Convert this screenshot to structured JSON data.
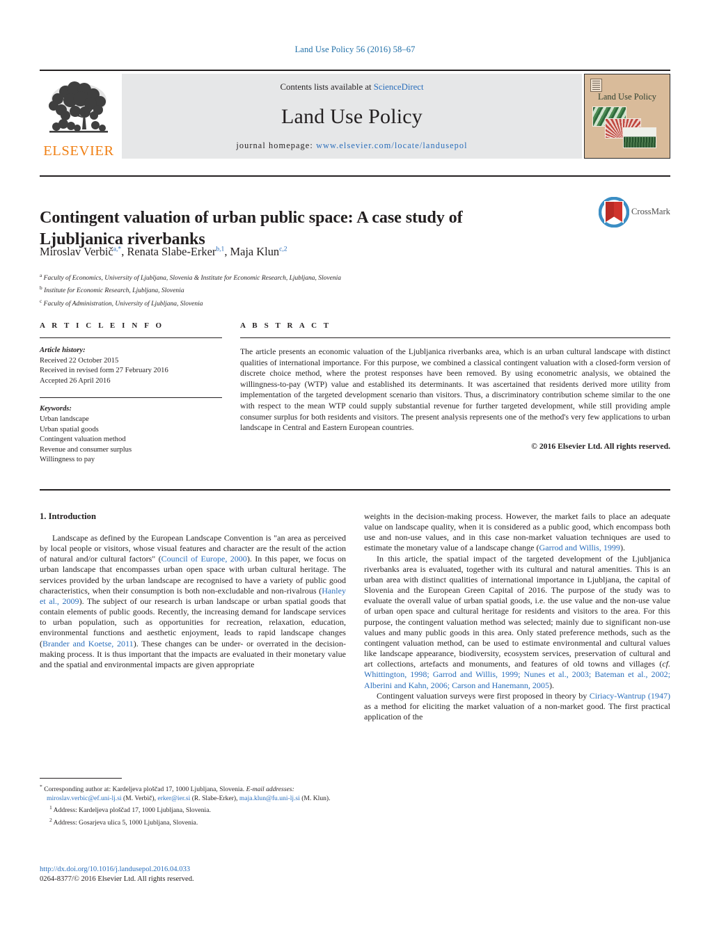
{
  "running_head": "Land Use Policy 56 (2016) 58–67",
  "masthead": {
    "contents_prefix": "Contents lists available at ",
    "sciencedirect": "ScienceDirect",
    "journal_name": "Land Use Policy",
    "homepage_prefix": "journal homepage: ",
    "homepage_url": "www.elsevier.com/locate/landusepol",
    "publisher_wordmark": "ELSEVIER",
    "cover_title": "Land Use Policy",
    "link_color": "#2a6ebb",
    "publisher_color": "#f07f13",
    "cover_bg": "#d9bb9a"
  },
  "article": {
    "title": "Contingent valuation of urban public space: A case study of Ljubljanica riverbanks",
    "authors": [
      {
        "name": "Miroslav Verbič",
        "marks": "a,*"
      },
      {
        "name": "Renata Slabe-Erker",
        "marks": "b,1"
      },
      {
        "name": "Maja Klun",
        "marks": "c,2"
      }
    ],
    "affiliations": [
      {
        "mark": "a",
        "text": "Faculty of Economics, University of Ljubljana, Slovenia & Institute for Economic Research, Ljubljana, Slovenia"
      },
      {
        "mark": "b",
        "text": "Institute for Economic Research, Ljubljana, Slovenia"
      },
      {
        "mark": "c",
        "text": "Faculty of Administration, University of Ljubljana, Slovenia"
      }
    ],
    "crossmark_label": "CrossMark"
  },
  "article_info": {
    "heading": "A R T I C L E   I N F O",
    "history_label": "Article history:",
    "history": [
      "Received 22 October 2015",
      "Received in revised form 27 February 2016",
      "Accepted 26 April 2016"
    ],
    "keywords_label": "Keywords:",
    "keywords": [
      "Urban landscape",
      "Urban spatial goods",
      "Contingent valuation method",
      "Revenue and consumer surplus",
      "Willingness to pay"
    ]
  },
  "abstract": {
    "heading": "A B S T R A C T",
    "text": "The article presents an economic valuation of the Ljubljanica riverbanks area, which is an urban cultural landscape with distinct qualities of international importance. For this purpose, we combined a classical contingent valuation with a closed-form version of discrete choice method, where the protest responses have been removed. By using econometric analysis, we obtained the willingness-to-pay (WTP) value and established its determinants. It was ascertained that residents derived more utility from implementation of the targeted development scenario than visitors. Thus, a discriminatory contribution scheme similar to the one with respect to the mean WTP could supply substantial revenue for further targeted development, while still providing ample consumer surplus for both residents and visitors. The present analysis represents one of the method's very few applications to urban landscape in Central and Eastern European countries.",
    "copyright": "© 2016 Elsevier Ltd. All rights reserved."
  },
  "body": {
    "section_number_title": "1.  Introduction",
    "left_paragraphs": [
      {
        "segments": [
          {
            "t": "Landscape as defined by the European Landscape Convention is \"an area as perceived by local people or visitors, whose visual features and character are the result of the action of natural and/or cultural factors\" (",
            "ref": false
          },
          {
            "t": "Council of Europe, 2000",
            "ref": true
          },
          {
            "t": "). In this paper, we focus on urban landscape that encompasses urban open space with urban cultural heritage. The services provided by the urban landscape are recognised to have a variety of public good characteristics, when their consumption is both non-excludable and non-rivalrous (",
            "ref": false
          },
          {
            "t": "Hanley et al., 2009",
            "ref": true
          },
          {
            "t": "). The subject of our research is urban landscape or urban spatial goods that contain elements of public goods. Recently, the increasing demand for landscape services to urban population, such as opportunities for recreation, relaxation, education, environmental functions and aesthetic enjoyment, leads to rapid landscape changes (",
            "ref": false
          },
          {
            "t": "Brander and Koetse, 2011",
            "ref": true
          },
          {
            "t": "). These changes can be under- or overrated in the decision-making process. It is thus important that the impacts are evaluated in their monetary value and the spatial and environmental impacts are given appropriate",
            "ref": false
          }
        ]
      }
    ],
    "right_paragraphs": [
      {
        "indent": false,
        "segments": [
          {
            "t": "weights in the decision-making process. However, the market fails to place an adequate value on landscape quality, when it is considered as a public good, which encompass both use and non-use values, and in this case non-market valuation techniques are used to estimate the monetary value of a landscape change (",
            "ref": false
          },
          {
            "t": "Garrod and Willis, 1999",
            "ref": true
          },
          {
            "t": ").",
            "ref": false
          }
        ]
      },
      {
        "indent": true,
        "segments": [
          {
            "t": "In this article, the spatial impact of the targeted development of the Ljubljanica riverbanks area is evaluated, together with its cultural and natural amenities. This is an urban area with distinct qualities of international importance in Ljubljana, the capital of Slovenia and the European Green Capital of 2016. The purpose of the study was to evaluate the overall value of urban spatial goods, i.e. the use value and the non-use value of urban open space and cultural heritage for residents and visitors to the area. For this purpose, the contingent valuation method was selected; mainly due to significant non-use values and many public goods in this area. Only stated preference methods, such as the contingent valuation method, can be used to estimate environmental and cultural values like landscape appearance, biodiversity, ecosystem services, preservation of cultural and art collections, artefacts and monuments, and features of old towns and villages (",
            "ref": false
          },
          {
            "t": "cf.",
            "ref": false,
            "italic": true
          },
          {
            "t": " ",
            "ref": false
          },
          {
            "t": "Whittington, 1998; Garrod and Willis, 1999; Nunes et al., 2003; Bateman et al., 2002; Alberini and Kahn, 2006; Carson and Hanemann, 2005",
            "ref": true
          },
          {
            "t": ").",
            "ref": false
          }
        ]
      },
      {
        "indent": true,
        "segments": [
          {
            "t": "Contingent valuation surveys were first proposed in theory by ",
            "ref": false
          },
          {
            "t": "Ciriacy-Wantrup (1947)",
            "ref": true
          },
          {
            "t": " as a method for eliciting the market valuation of a non-market good. The first practical application of the",
            "ref": false
          }
        ]
      }
    ]
  },
  "footnotes": {
    "corresponding": {
      "mark": "*",
      "line1": "Corresponding author at: Kardeljeva ploščad 17, 1000 Ljubljana, Slovenia.",
      "email_label": "E-mail addresses:",
      "emails": [
        {
          "addr": "miroslav.verbic@ef.uni-lj.si",
          "who": "(M. Verbič)"
        },
        {
          "addr": "erker@ier.si",
          "who": "(R. Slabe-Erker)"
        },
        {
          "addr": "maja.klun@fu.uni-lj.si",
          "who": "(M. Klun)"
        }
      ]
    },
    "numbered": [
      {
        "mark": "1",
        "text": "Address: Kardeljeva ploščad 17, 1000 Ljubljana, Slovenia."
      },
      {
        "mark": "2",
        "text": "Address: Gosarjeva ulica 5, 1000 Ljubljana, Slovenia."
      }
    ]
  },
  "footer": {
    "doi_url": "http://dx.doi.org/10.1016/j.landusepol.2016.04.033",
    "issn_copyright": "0264-8377/© 2016 Elsevier Ltd. All rights reserved."
  }
}
